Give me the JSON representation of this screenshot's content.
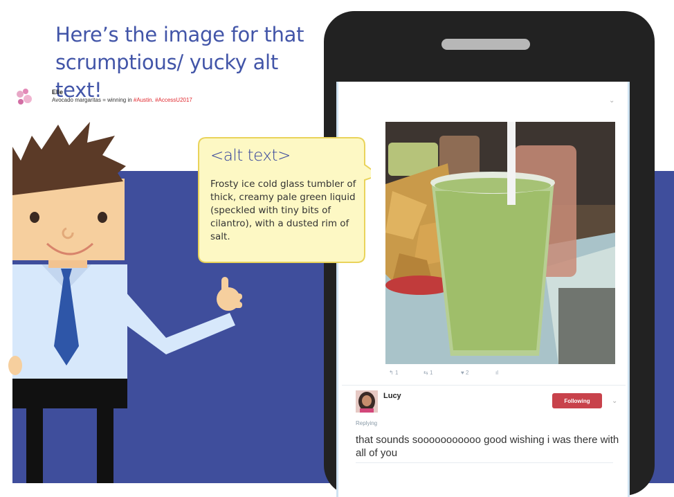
{
  "slide": {
    "headline": "Here’s the image for that scrumptious/ yucky alt text!",
    "colors": {
      "band": "#3f4e9c",
      "headline": "#4255a8",
      "callout_bg": "#fdf8c4",
      "callout_border": "#e9d35a",
      "follow": "#c8424b",
      "hashtag": "#e0282e"
    }
  },
  "callout": {
    "title": "<alt text>",
    "body": "Frosty ice cold glass tumbler of thick, creamy pale green liquid (speckled with tiny bits of cilantro), with a dusted rim of salt."
  },
  "tweet": {
    "author": "Elle",
    "text_prefix": "Avocado margaritas = winning in ",
    "hashtags": [
      "#Austin",
      "#AccessU2017"
    ],
    "hashtag_separator": ". ",
    "actions": [
      {
        "icon": "reply-icon",
        "glyph": "↰",
        "count": "1"
      },
      {
        "icon": "retweet-icon",
        "glyph": "⇆",
        "count": "1"
      },
      {
        "icon": "heart-icon",
        "glyph": "♥",
        "count": "2"
      },
      {
        "icon": "analytics-icon",
        "glyph": "ıl",
        "count": ""
      }
    ]
  },
  "reply": {
    "author": "Lucy",
    "follow_label": "Following",
    "replying_label": "Replying",
    "text": "that sounds sooooooooooo good wishing i was there with all of you"
  }
}
